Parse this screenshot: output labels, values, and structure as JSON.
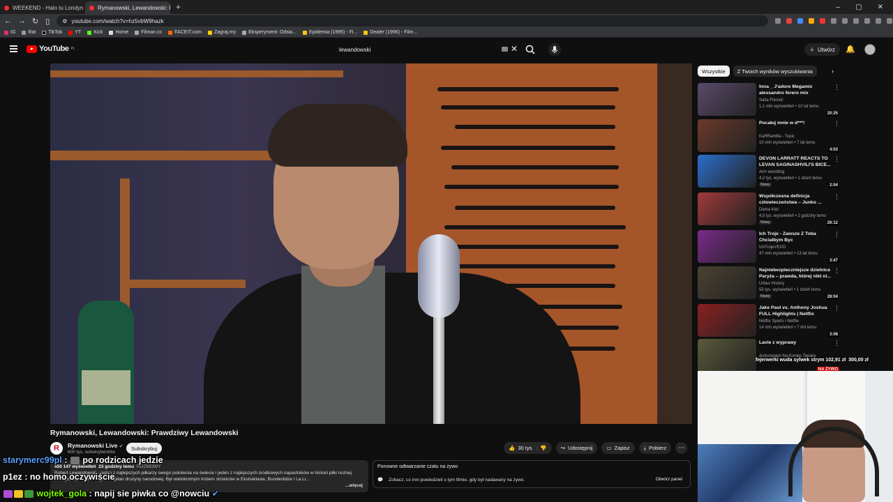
{
  "browser": {
    "tabs": [
      {
        "label": "WEEKEND - Halo tu Londyn (Oficjal..."
      },
      {
        "label": "Rymanowski, Lewandowski: P..."
      }
    ],
    "new_tab": "+",
    "url": "youtube.com/watch?v=hz5vbW9hazk",
    "bookmarks": [
      "IG",
      "Rat",
      "TikTok",
      "YT",
      "Kick",
      "Home",
      "Filman.cc",
      "FACEIT.com",
      "Zagraj.my",
      "Eksperyment: Odsia...",
      "Epidemia (1995) - Fi...",
      "Dealer (1996) - Film..."
    ]
  },
  "youtube": {
    "logo": "YouTube",
    "region": "PL",
    "search_value": "lewandowski",
    "create_label": "Utwórz"
  },
  "video": {
    "title": "Rymanowski, Lewandowski: Prawdziwy Lewandowski",
    "channel": "Rymanowski Live",
    "channel_initial": "R",
    "subscribers": "600 tys. subskrybentów",
    "subscribe_label": "Subskrybuj",
    "likes": "30 tys.",
    "share_label": "Udostępnij",
    "save_label": "Zapisz",
    "download_label": "Pobierz",
    "views": "450 147 wyświetleń",
    "posted": "23 godziny temu",
    "tag": "ROZMOWY",
    "description": "Robert Lewandowski - jeden z najlepszych piłkarzy swego pokolenia na świecie i jeden z najlepszych środkowych napastników w historii piłki nożnej. Zdobywca ponad 600 goli. Kapitan drużyny narodowej. Był wielokrotnym królem strzelców w Ekstraklasie, Bundeslidze i La Li...",
    "more_label": "...więcej"
  },
  "replay": {
    "title": "Ponowne odtwarzanie czatu na żywo",
    "subtitle": "Zobacz, co inni powiedzieli o tym filmie, gdy był nadawany na żywo.",
    "open_panel": "Otwórz panel"
  },
  "sidebar": {
    "chips": [
      "Wszystkie",
      "Z Twoich wyników wyszukiwania"
    ],
    "items": [
      {
        "title": "Inna _ J'adore Megamix alessandro ferero mix",
        "channel": "Saša Frković",
        "meta": "1,1 mln wyświetleń • 10 lat temu",
        "duration": "20:25",
        "badge": "",
        "color": "#5a4a6a"
      },
      {
        "title": "Pocałuj mnie w d***!",
        "channel": "KaRRamBa - Topic",
        "meta": "10 mln wyświetleń • 7 lat temu",
        "duration": "4:03",
        "badge": "",
        "color": "#6b3a2a"
      },
      {
        "title": "DEVON LARRATT REACTS TO LEVAN SAGINASHVILI'S BICE...",
        "channel": "Arm wrestling",
        "meta": "4,2 tys. wyświetleń • 1 dzień temu",
        "duration": "2:04",
        "badge": "Nowy",
        "color": "#2c6ecb"
      },
      {
        "title": "Współczesna definicja człowieczeństwa – Junko ...",
        "channel": "Dama Kier",
        "meta": "4,5 tys. wyświetleń • 2 godziny temu",
        "duration": "26:12",
        "badge": "Nowy",
        "color": "#a03a3a"
      },
      {
        "title": "Ich Troje - Zawsze Z Toba Chcialbym Byc",
        "channel": "IchTrojeVEVO",
        "meta": "47 mln wyświetleń • 13 lat temu",
        "duration": "3:47",
        "badge": "",
        "color": "#7a2a8a"
      },
      {
        "title": "Najniebezpieczniejsze dzielnice Paryża – prawda, której nikt ni...",
        "channel": "Urbex History",
        "meta": "55 tys. wyświetleń • 1 dzień temu",
        "duration": "28:04",
        "badge": "Nowy",
        "color": "#4a4232"
      },
      {
        "title": "Jake Paul vs. Anthony Joshua FULL Highlights | Netflix",
        "channel": "Netflix Sports i Netflix",
        "meta": "14 mln wyświetleń • 7 dni temu",
        "duration": "3:08",
        "badge": "",
        "color": "#8a2020"
      },
      {
        "title": "Lavie z wyprawy",
        "channel": "Autostopem Na Koniec Świata",
        "meta": "",
        "duration": "NA ŻYWO",
        "badge": "",
        "color": "#5a5a3a"
      }
    ]
  },
  "stream": {
    "donation_text": "fejerwerki wuda sylwek strym 102,91 zł",
    "donation_total": "300,00 zł",
    "chat": [
      {
        "user": "starymerc99pl",
        "sep": " : ",
        "msg": "po rodzicach jedzie"
      },
      {
        "user": "p1ez",
        "sep": " : ",
        "msg": "no homo oczywiście"
      },
      {
        "user": "wojtek_gola",
        "sep": " : ",
        "msg": "napij sie piwka co @nowciu"
      }
    ]
  }
}
